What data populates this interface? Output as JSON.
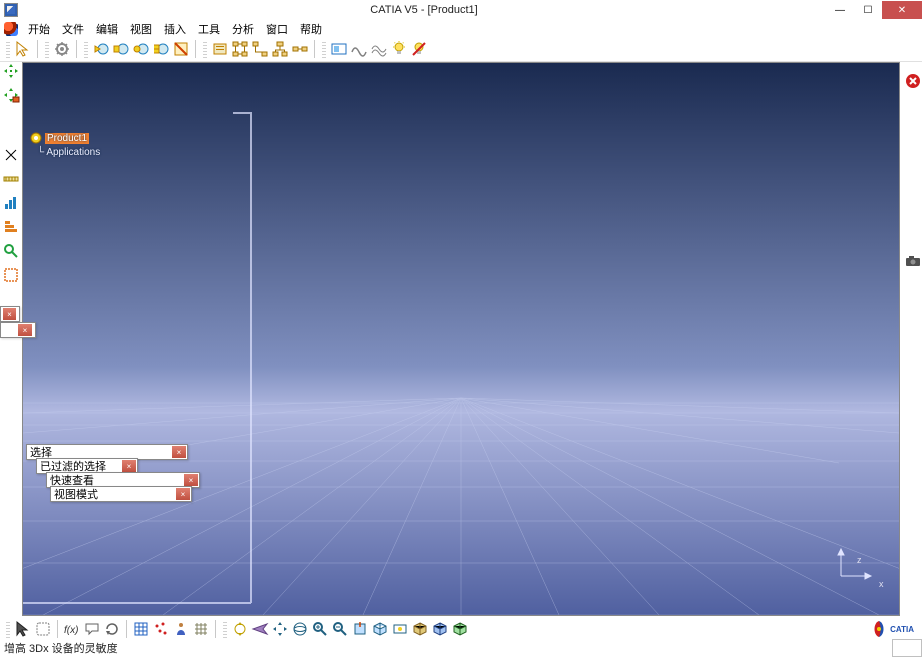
{
  "title": "CATIA V5 - [Product1]",
  "menu": {
    "items": [
      "开始",
      "文件",
      "编辑",
      "视图",
      "插入",
      "工具",
      "分析",
      "窗口",
      "帮助"
    ]
  },
  "tree": {
    "root": "Product1",
    "child": "Applications"
  },
  "panels": {
    "p1_label": "选择",
    "p2_label": "已过滤的选择",
    "p3_label": "快速查看",
    "p4_label": "视图模式"
  },
  "axes": {
    "x": "x",
    "z": "z"
  },
  "status": {
    "msg": "增高 3Dx 设备的灵敏度"
  },
  "logo": {
    "brand": "CATIA",
    "ds": "DS"
  },
  "toolbar_top_icons": [
    "arrow",
    "gear-select",
    "clash-globe",
    "clash-globe-2",
    "clash-globe-3",
    "clash-globe-4",
    "section",
    "hide-show",
    "tree-expand",
    "tree-collapse",
    "tree-sync",
    "tree-align",
    "capture",
    "wave-1",
    "wave-2",
    "light-bulb",
    "no-entry"
  ],
  "toolbar_left_icons": [
    "move-4way",
    "move-4way-lock",
    "x",
    "measure",
    "graph",
    "graph-h",
    "search-green",
    "sketch-orange"
  ],
  "toolbar_bottom_icons": [
    "arrow",
    "grab",
    "fx",
    "speech",
    "rotate",
    "grid",
    "point-cluster",
    "person",
    "mesh",
    "sep",
    "pan-rotate",
    "fly",
    "4way",
    "zoom-fit",
    "zoom-in",
    "zoom-out",
    "iso",
    "normal",
    "look-at",
    "cube",
    "box-1",
    "box-2"
  ],
  "right_icons": [
    "close-red",
    "camera"
  ]
}
